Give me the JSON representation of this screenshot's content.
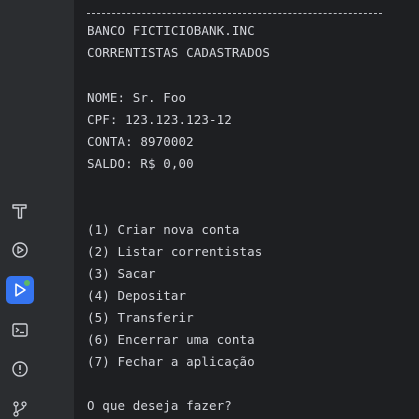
{
  "console": {
    "separator": "----------------------------------------",
    "header": {
      "bank_name": "BANCO FICTICIOBANK.INC",
      "subtitle": "CORRENTISTAS CADASTRADOS"
    },
    "account": {
      "name_line": "NOME: Sr. Foo",
      "cpf_line": "CPF: 123.123.123-12",
      "account_line": "CONTA: 8970002",
      "balance_line": "SALDO: R$ 0,00"
    },
    "menu": [
      "(1) Criar nova conta",
      "(2) Listar correntistas",
      "(3) Sacar",
      "(4) Depositar",
      "(5) Transferir",
      "(6) Encerrar uma conta",
      "(7) Fechar a aplicação"
    ],
    "prompt": "O que deseja fazer?"
  },
  "toolbar": {
    "items": [
      {
        "icon": "build-hammer-icon",
        "active": false
      },
      {
        "icon": "debug-play-circle-icon",
        "active": false
      },
      {
        "icon": "run-icon",
        "active": true
      },
      {
        "icon": "terminal-icon",
        "active": false
      },
      {
        "icon": "problems-icon",
        "active": false
      },
      {
        "icon": "git-icon",
        "active": false
      }
    ]
  },
  "colors": {
    "background": "#1e1f22",
    "sidebar": "#2b2d30",
    "text": "#d4d6dc",
    "accent": "#3574f0",
    "run_status": "#5fb865"
  }
}
